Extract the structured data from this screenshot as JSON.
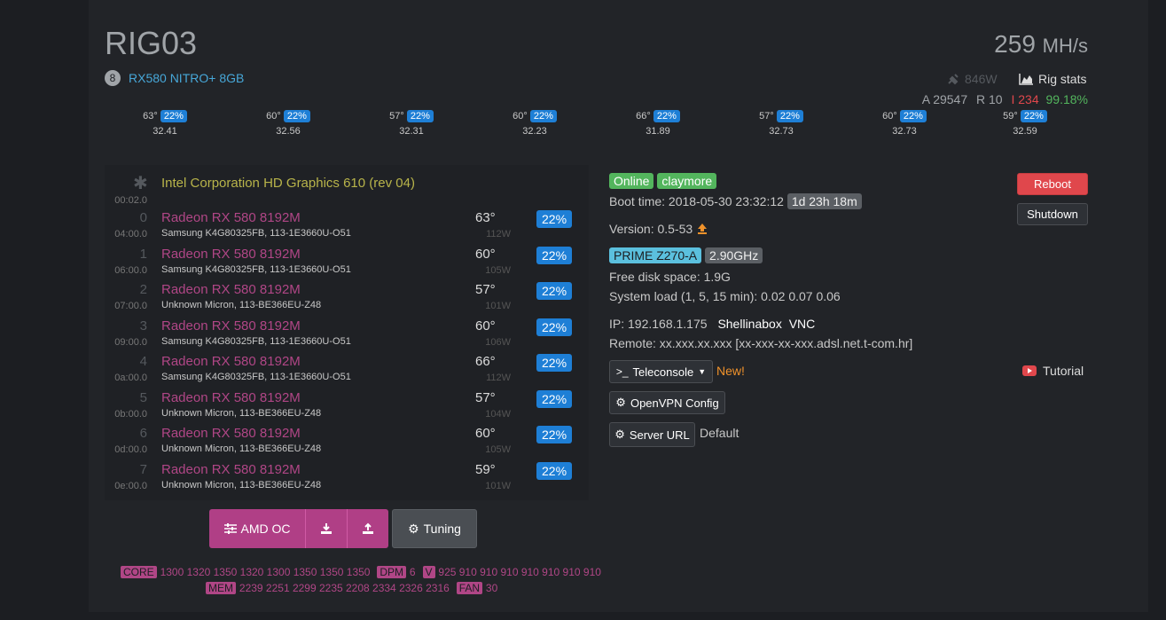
{
  "rig": {
    "name": "RIG03",
    "gpu_count": "8",
    "gpu_model": "RX580 NITRO+ 8GB",
    "hashrate": "259",
    "hashrate_unit": "MH/s",
    "power": "846W",
    "rig_stats_label": "Rig stats",
    "accepted": "A 29547",
    "rejected": "R 10",
    "invalid": "I 234",
    "efficiency": "99.18%"
  },
  "summary_gpus": [
    {
      "temp": "63°",
      "fan": "22%",
      "hash": "32.41"
    },
    {
      "temp": "60°",
      "fan": "22%",
      "hash": "32.56"
    },
    {
      "temp": "57°",
      "fan": "22%",
      "hash": "32.31"
    },
    {
      "temp": "60°",
      "fan": "22%",
      "hash": "32.23"
    },
    {
      "temp": "66°",
      "fan": "22%",
      "hash": "31.89"
    },
    {
      "temp": "57°",
      "fan": "22%",
      "hash": "32.73"
    },
    {
      "temp": "60°",
      "fan": "22%",
      "hash": "32.73"
    },
    {
      "temp": "59°",
      "fan": "22%",
      "hash": "32.59"
    }
  ],
  "igpu": {
    "name": "Intel Corporation HD Graphics 610 (rev 04)",
    "bus": "00:02.0"
  },
  "gpus": [
    {
      "idx": "0",
      "bus": "04:00.0",
      "name": "Radeon RX 580 8192M",
      "mem": "Samsung K4G80325FB, 113-1E3660U-O51",
      "temp": "63°",
      "power": "112W",
      "fan": "22%"
    },
    {
      "idx": "1",
      "bus": "06:00.0",
      "name": "Radeon RX 580 8192M",
      "mem": "Samsung K4G80325FB, 113-1E3660U-O51",
      "temp": "60°",
      "power": "105W",
      "fan": "22%"
    },
    {
      "idx": "2",
      "bus": "07:00.0",
      "name": "Radeon RX 580 8192M",
      "mem": "Unknown Micron, 113-BE366EU-Z48",
      "temp": "57°",
      "power": "101W",
      "fan": "22%"
    },
    {
      "idx": "3",
      "bus": "09:00.0",
      "name": "Radeon RX 580 8192M",
      "mem": "Samsung K4G80325FB, 113-1E3660U-O51",
      "temp": "60°",
      "power": "106W",
      "fan": "22%"
    },
    {
      "idx": "4",
      "bus": "0a:00.0",
      "name": "Radeon RX 580 8192M",
      "mem": "Samsung K4G80325FB, 113-1E3660U-O51",
      "temp": "66°",
      "power": "112W",
      "fan": "22%"
    },
    {
      "idx": "5",
      "bus": "0b:00.0",
      "name": "Radeon RX 580 8192M",
      "mem": "Unknown Micron, 113-BE366EU-Z48",
      "temp": "57°",
      "power": "104W",
      "fan": "22%"
    },
    {
      "idx": "6",
      "bus": "0d:00.0",
      "name": "Radeon RX 580 8192M",
      "mem": "Unknown Micron, 113-BE366EU-Z48",
      "temp": "60°",
      "power": "105W",
      "fan": "22%"
    },
    {
      "idx": "7",
      "bus": "0e:00.0",
      "name": "Radeon RX 580 8192M",
      "mem": "Unknown Micron, 113-BE366EU-Z48",
      "temp": "59°",
      "power": "101W",
      "fan": "22%"
    }
  ],
  "oc": {
    "amd_oc_label": "AMD OC",
    "tuning_label": "Tuning",
    "core_tag": "CORE",
    "core_values": "1300 1320 1350 1320 1300 1350 1350 1350",
    "dpm_tag": "DPM",
    "dpm_value": "6",
    "v_tag": "V",
    "v_values": "925 910 910 910 910 910 910 910",
    "mem_tag": "MEM",
    "mem_values": "2239 2251 2299 2235 2208 2334 2326 2316",
    "fan_tag": "FAN",
    "fan_value": "30"
  },
  "status": {
    "online": "Online",
    "miner": "claymore",
    "boot_time": "Boot time: 2018-05-30 23:32:12",
    "uptime": "1d 23h 18m",
    "version": "Version: 0.5-53",
    "motherboard": "PRIME Z270-A",
    "cpu_freq": "2.90GHz",
    "disk": "Free disk space: 1.9G",
    "load": "System load (1, 5, 15 min): 0.02 0.07 0.06",
    "ip": "IP: 192.168.1.175",
    "shellinabox": "Shellinabox",
    "vnc": "VNC",
    "remote": "Remote: xx.xxx.xx.xxx [xx-xxx-xx-xxx.adsl.net.t-com.hr]",
    "teleconsole": "Teleconsole",
    "new_label": "New!",
    "tutorial": "Tutorial",
    "openvpn": "OpenVPN Config",
    "server_url": "Server URL",
    "server_url_value": "Default"
  },
  "actions": {
    "reboot": "Reboot",
    "shutdown": "Shutdown"
  }
}
